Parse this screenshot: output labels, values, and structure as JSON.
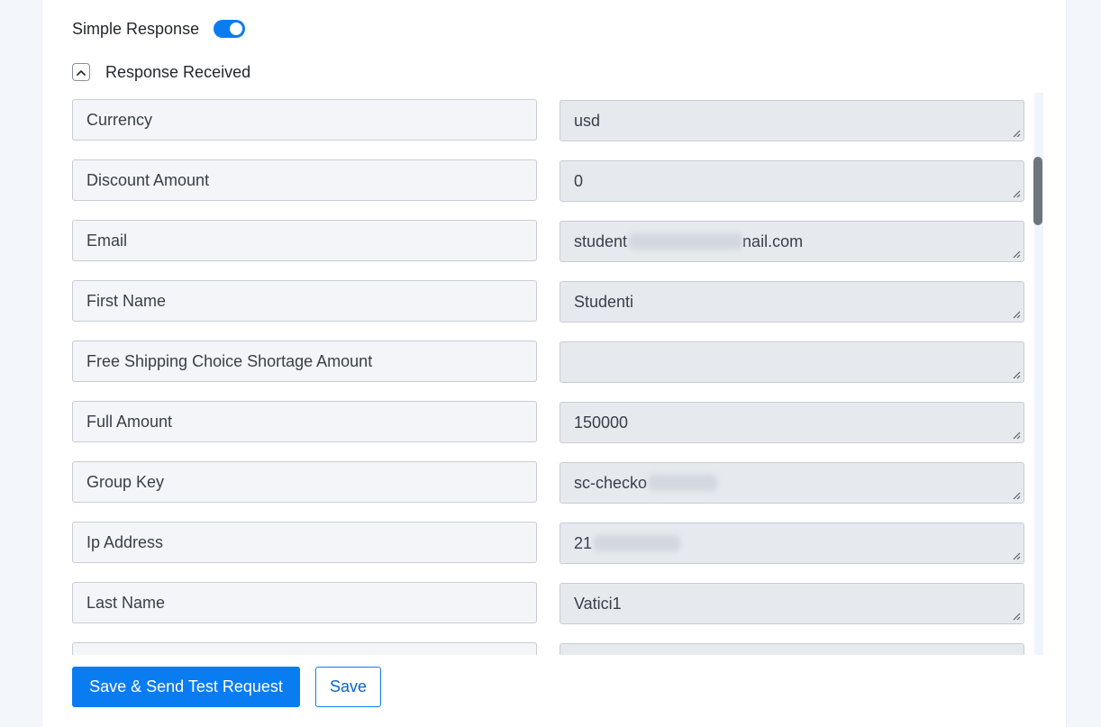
{
  "simple_response": {
    "label": "Simple Response",
    "enabled": true
  },
  "response_section": {
    "label": "Response Received",
    "expanded": true
  },
  "fields": [
    {
      "key": "Currency",
      "value": "usd",
      "value_suffix": ""
    },
    {
      "key": "Discount Amount",
      "value": "0",
      "value_suffix": ""
    },
    {
      "key": "Email",
      "value": "student",
      "value_suffix": "nail.com",
      "redacted": true
    },
    {
      "key": "First Name",
      "value": "Studenti",
      "value_suffix": ""
    },
    {
      "key": "Free Shipping Choice Shortage Amount",
      "value": "",
      "value_suffix": ""
    },
    {
      "key": "Full Amount",
      "value": "150000",
      "value_suffix": ""
    },
    {
      "key": "Group Key",
      "value": "sc-checko",
      "value_suffix": "",
      "redacted": true
    },
    {
      "key": "Ip Address",
      "value": "21",
      "value_suffix": "",
      "redacted": true
    },
    {
      "key": "Last Name",
      "value": "Vatici1",
      "value_suffix": ""
    },
    {
      "key": "",
      "value": "",
      "value_suffix": ""
    }
  ],
  "actions": {
    "save_and_send_label": "Save & Send Test Request",
    "save_label": "Save"
  },
  "colors": {
    "accent": "#0a7cf2",
    "key_bg": "#f3f5f8",
    "value_bg": "#e6e9ee",
    "page_bg": "#f3f6fa"
  },
  "icons": {
    "collapse": "chevron-up-icon",
    "resize": "resize-grip-icon"
  }
}
